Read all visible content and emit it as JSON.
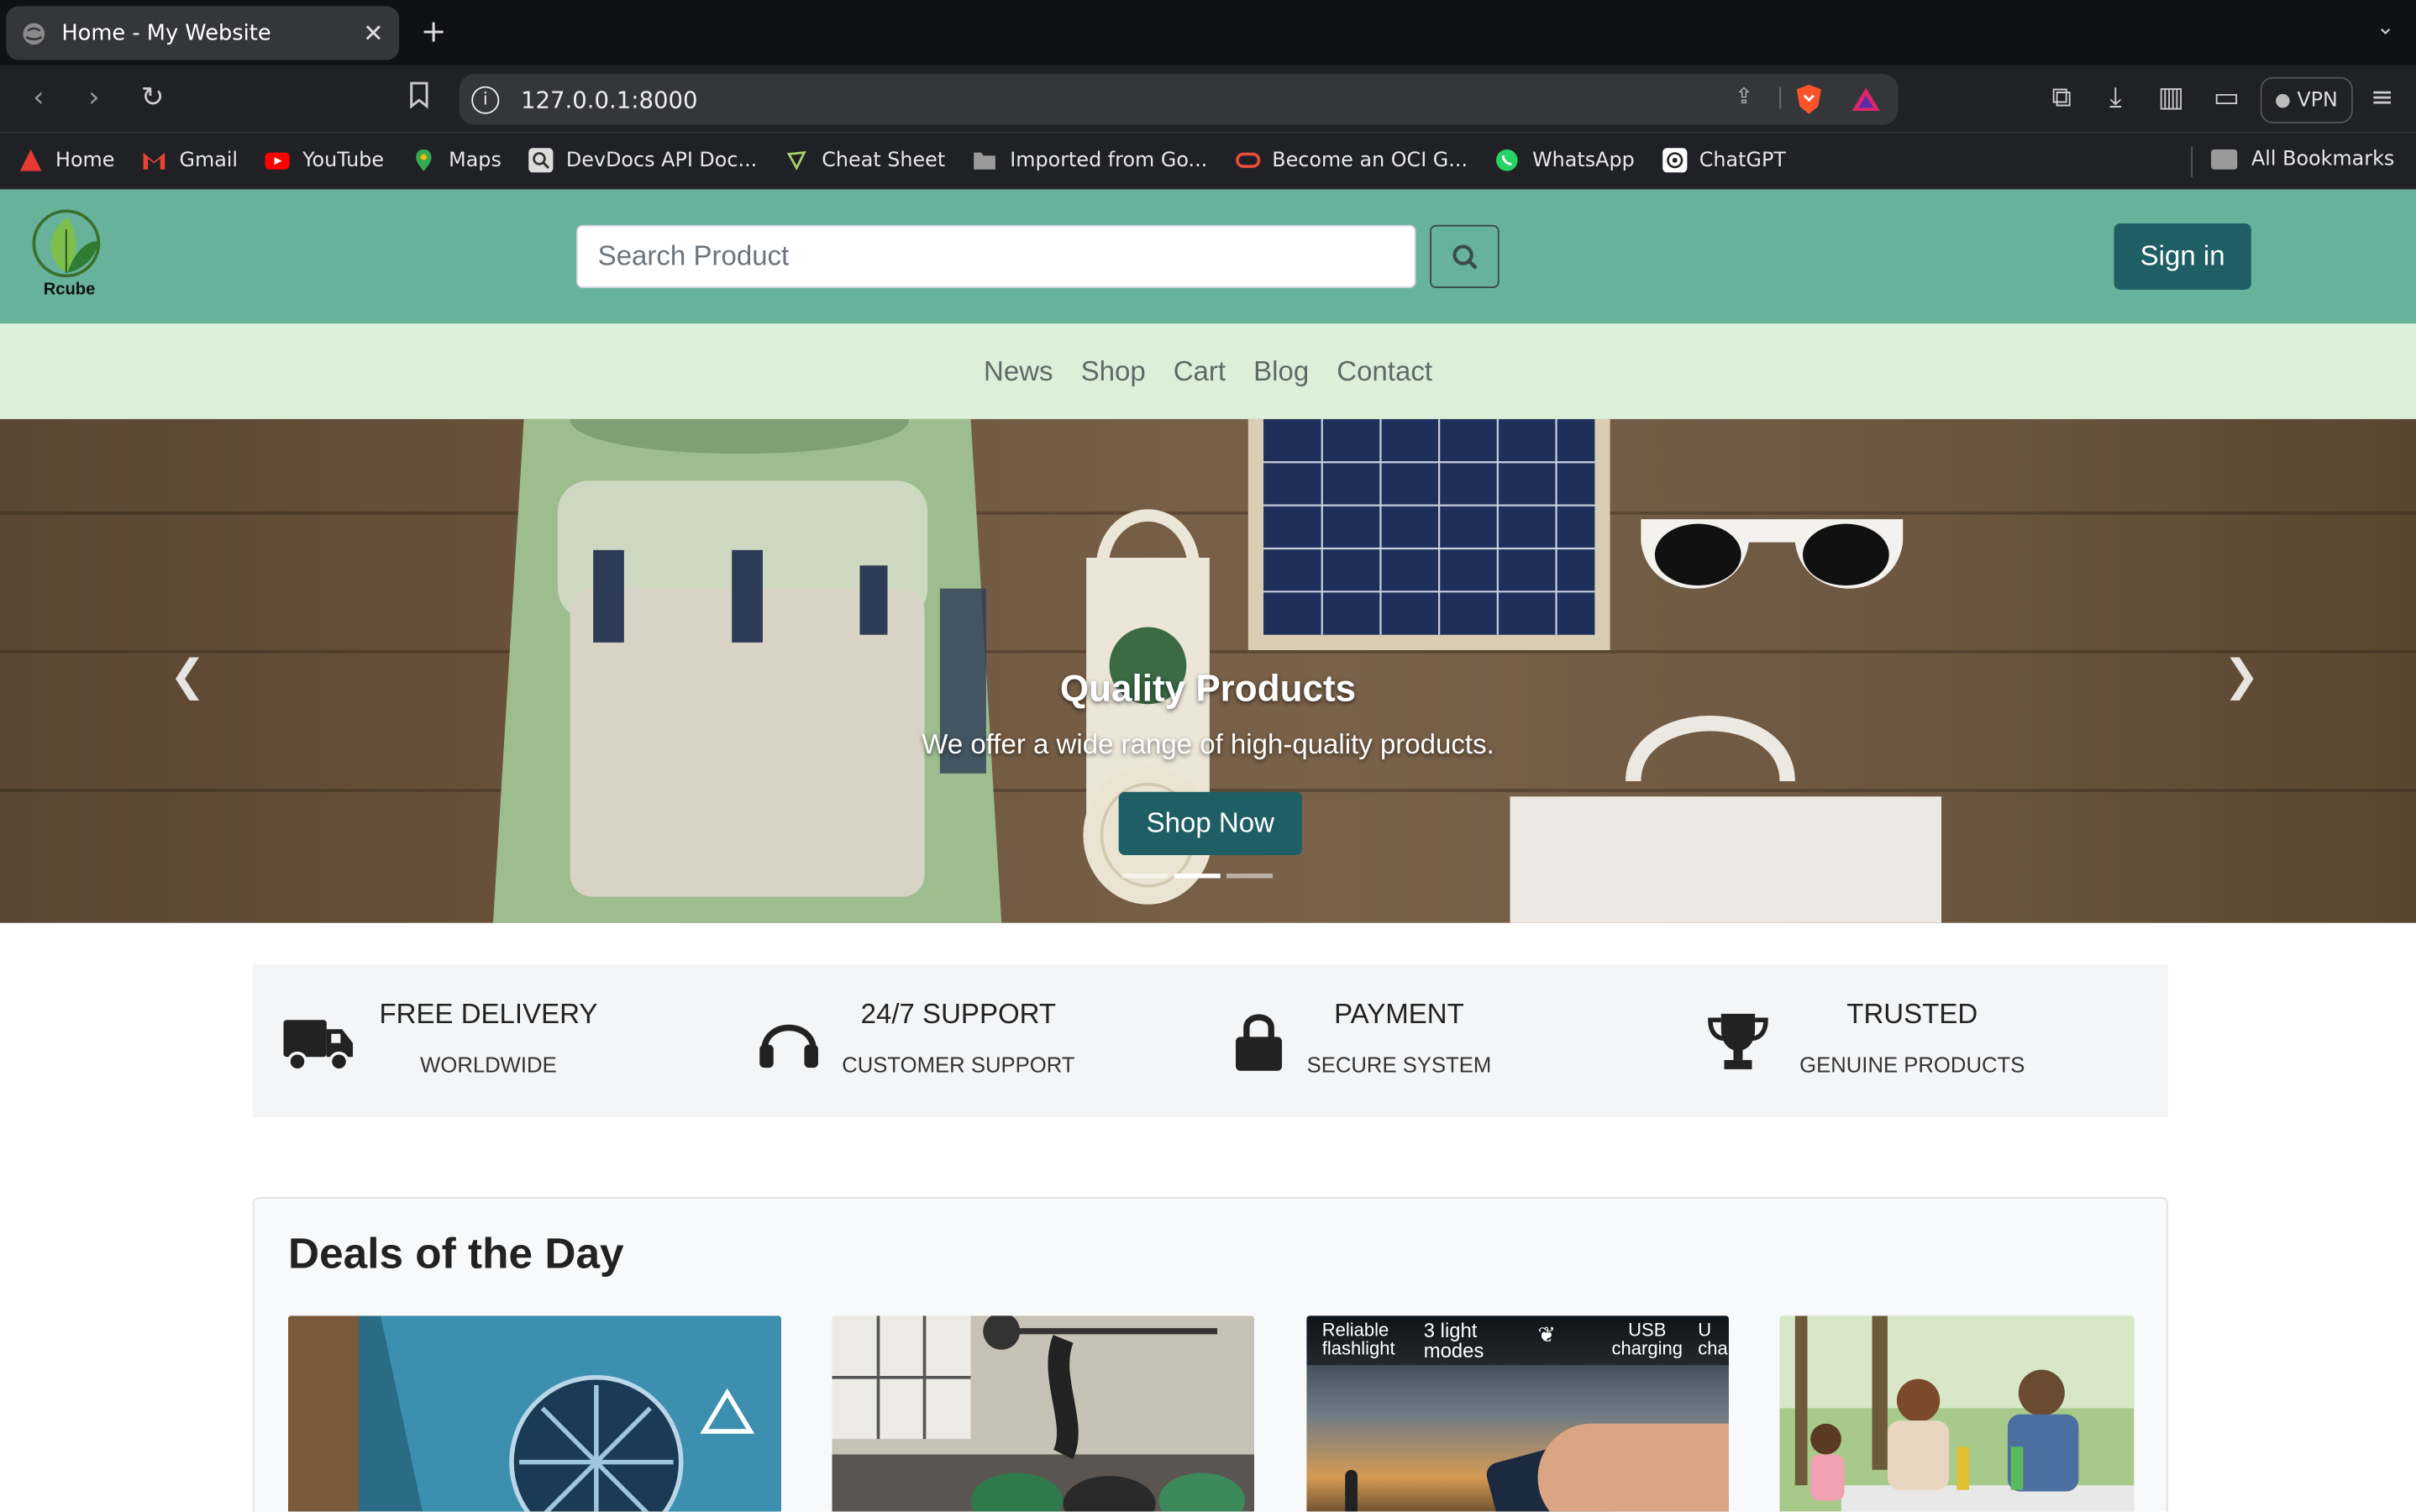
{
  "browser": {
    "tab_title": "Home - My Website",
    "url": "127.0.0.1:8000",
    "vpn_label": "VPN",
    "bookmarks": [
      "Home",
      "Gmail",
      "YouTube",
      "Maps",
      "DevDocs API Doc...",
      "Cheat Sheet",
      "Imported from Go...",
      "Become an OCI G...",
      "WhatsApp",
      "ChatGPT"
    ],
    "all_bookmarks": "All Bookmarks"
  },
  "header": {
    "logo_text": "Rcube",
    "search_placeholder": "Search Product",
    "signin_label": "Sign in"
  },
  "nav": [
    "News",
    "Shop",
    "Cart",
    "Blog",
    "Contact"
  ],
  "hero": {
    "title": "Quality Products",
    "subtitle": "We offer a wide range of high-quality products.",
    "button": "Shop Now",
    "active_slide": 2,
    "slide_count": 3
  },
  "features": [
    {
      "title": "FREE DELIVERY",
      "sub": "WORLDWIDE",
      "icon": "truck-icon"
    },
    {
      "title": "24/7 SUPPORT",
      "sub": "CUSTOMER SUPPORT",
      "icon": "headphones-icon"
    },
    {
      "title": "PAYMENT",
      "sub": "SECURE SYSTEM",
      "icon": "lock-icon"
    },
    {
      "title": "TRUSTED",
      "sub": "GENUINE PRODUCTS",
      "icon": "trophy-icon"
    }
  ],
  "deals": {
    "title": "Deals of the Day",
    "cards": [
      {
        "image_text": []
      },
      {
        "image_text": []
      },
      {
        "image_text": [
          "Reliable flashlight",
          "3 light modes",
          "USB charging",
          "U cha"
        ]
      },
      {
        "image_text": []
      }
    ]
  },
  "colors": {
    "header": "#66b29b",
    "nav": "#dcefd9",
    "primary": "#1e5e64"
  }
}
